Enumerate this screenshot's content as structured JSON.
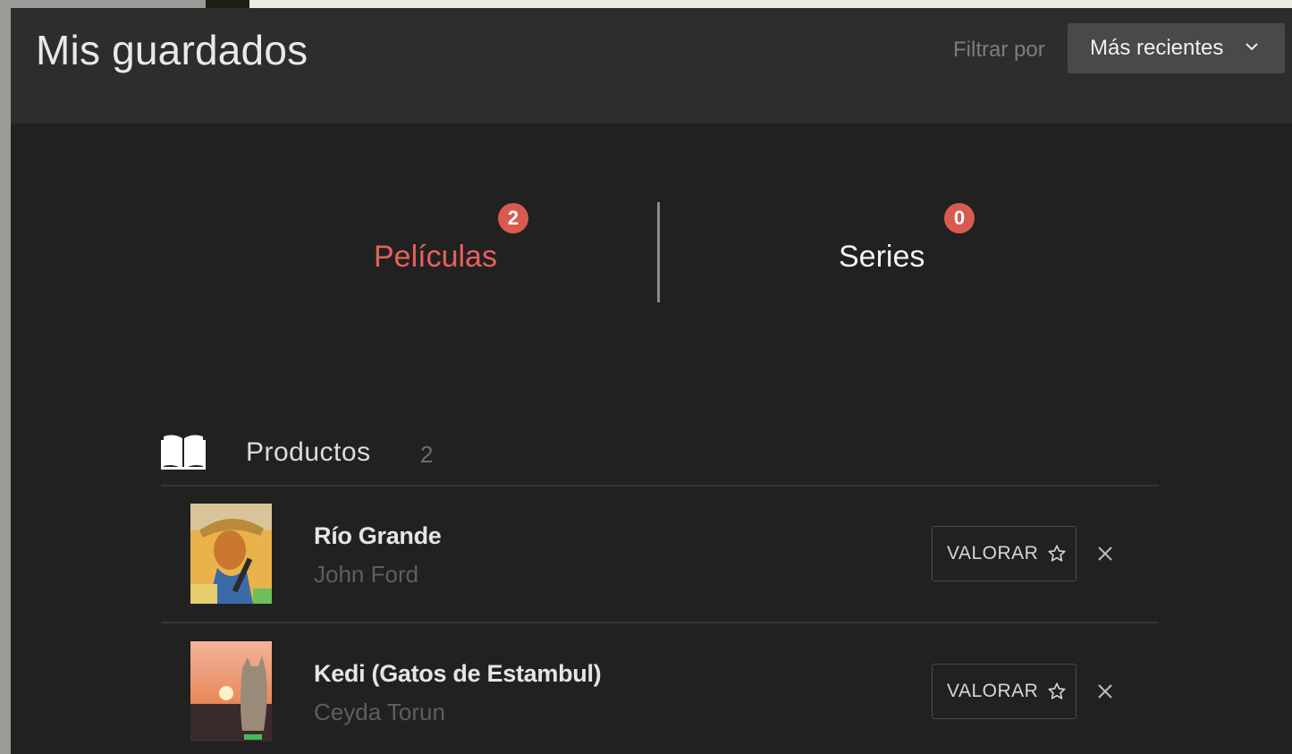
{
  "header": {
    "title": "Mis guardados",
    "filter_label": "Filtrar por",
    "sort_value": "Más recientes"
  },
  "tabs": [
    {
      "label": "Películas",
      "count": "2",
      "active": true
    },
    {
      "label": "Series",
      "count": "0",
      "active": false
    }
  ],
  "section": {
    "icon": "book-icon",
    "title": "Productos",
    "count": "2"
  },
  "items": [
    {
      "title": "Río Grande",
      "author": "John Ford",
      "rate_label": "VALORAR"
    },
    {
      "title": "Kedi (Gatos de Estambul)",
      "author": "Ceyda Torun",
      "rate_label": "VALORAR"
    }
  ],
  "colors": {
    "accent": "#e2625a",
    "badge": "#d95a50",
    "background": "#222122",
    "header": "#2d2d2e"
  }
}
